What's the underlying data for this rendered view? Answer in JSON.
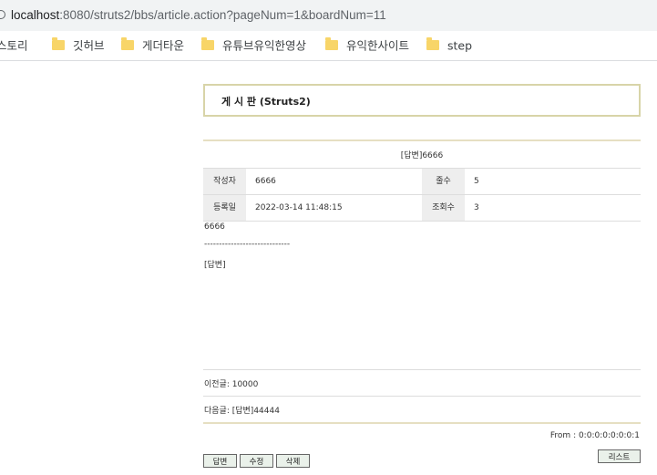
{
  "browser": {
    "url_host": "localhost",
    "url_path": ":8080/struts2/bbs/article.action?pageNum=1&boardNum=11",
    "bookmarks": [
      {
        "label": "스토리",
        "icon": "folder-icon",
        "has_icon": false
      },
      {
        "label": "깃허브",
        "icon": "folder-icon",
        "has_icon": true
      },
      {
        "label": "게더타운",
        "icon": "folder-icon",
        "has_icon": true
      },
      {
        "label": "유튜브유익한영상",
        "icon": "folder-icon",
        "has_icon": true
      },
      {
        "label": "유익한사이트",
        "icon": "folder-icon",
        "has_icon": true
      },
      {
        "label": "step",
        "icon": "folder-icon",
        "has_icon": true
      }
    ]
  },
  "board": {
    "title": "게 시 판 (Struts2)",
    "subject": "[답변]6666",
    "fields": {
      "writer_label": "작성자",
      "writer": "6666",
      "lines_label": "줄수",
      "lines": "5",
      "created_label": "등록일",
      "created": "2022-03-14 11:48:15",
      "hits_label": "조회수",
      "hits": "3"
    },
    "content_lines": [
      "6666",
      "-----------------------------",
      "[답변]"
    ],
    "prev": "이전글: 10000",
    "next": "다음글: [답변]44444",
    "from": "From : 0:0:0:0:0:0:0:1",
    "buttons": {
      "reply": "답변",
      "edit": "수정",
      "delete": "삭제",
      "list": "리스트"
    }
  },
  "colors": {
    "title_border": "#d8d4a8",
    "separator": "#e6dfc2",
    "label_bg": "#eeeeee",
    "button_bg": "#eaf1ea"
  }
}
